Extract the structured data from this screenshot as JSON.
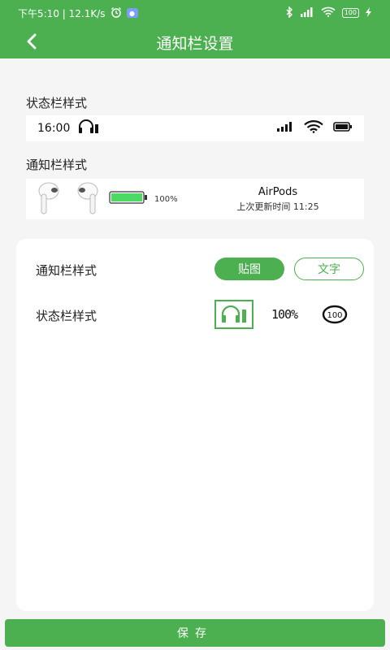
{
  "status_bar": {
    "left_text": "下午5:10 | 12.1K/s",
    "battery": "100"
  },
  "app_bar": {
    "title": "通知栏设置"
  },
  "status_style_section": {
    "label": "状态栏样式",
    "preview_time": "16:00"
  },
  "notify_style_section": {
    "label": "通知栏样式",
    "battery_percent": "100%",
    "battery_level": 1.0,
    "device_name": "AirPods",
    "last_update": "上次更新时间 11:25"
  },
  "settings": {
    "notify_row": {
      "label": "通知栏样式",
      "options": [
        "贴图",
        "文字"
      ],
      "selected": "贴图"
    },
    "status_row": {
      "label": "状态栏样式",
      "options": [
        "headphones-battery-icon",
        "100%",
        "100"
      ],
      "selected": "headphones-battery-icon"
    }
  },
  "save_button": {
    "label": "保存"
  },
  "colors": {
    "accent": "#4caf50",
    "battery_fill": "#4cd964"
  }
}
